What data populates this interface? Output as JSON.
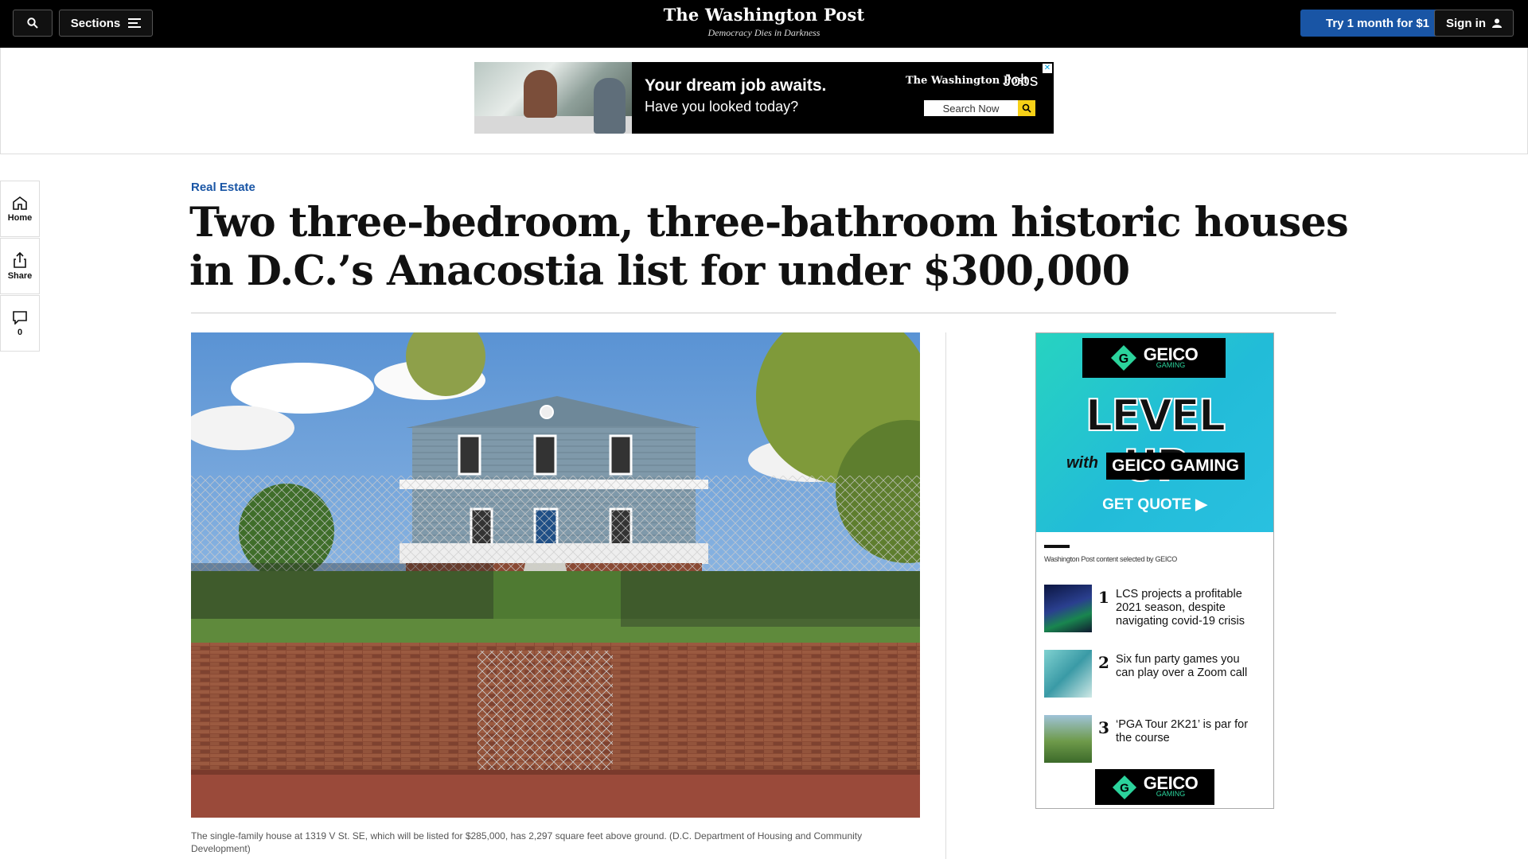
{
  "topbar": {
    "search_icon": "search-icon",
    "sections_label": "Sections",
    "logo": "The Washington Post",
    "tagline": "Democracy Dies in Darkness",
    "try_label": "Try 1 month for $1",
    "signin_label": "Sign in"
  },
  "top_ad": {
    "headline": "Your dream job awaits.",
    "subline": "Have you looked today?",
    "logo": "The Washington Post",
    "jobs": "Jobs",
    "search_label": "Search Now"
  },
  "rail": {
    "home": "Home",
    "share": "Share",
    "comments_count": "0"
  },
  "article": {
    "kicker": "Real Estate",
    "headline": "Two three-bedroom, three-bathroom historic houses in D.C.’s Anacostia list for under $300,000",
    "caption": "The single-family house at 1319 V St. SE, which will be listed for $285,000, has 2,297 square feet above ground. (D.C. Department of Housing and Community Development)"
  },
  "side_ad": {
    "brand": "GEICO",
    "brand_sub": "GAMING",
    "level_up": "LEVEL UP",
    "with": "with",
    "geico_gaming": "GEICO GAMING",
    "get_quote": "GET QUOTE ▶",
    "selected_by": "Washington Post content selected by GEICO",
    "items": [
      {
        "num": "1",
        "title": "LCS projects a profitable 2021 season, despite navigating covid-19 crisis"
      },
      {
        "num": "2",
        "title": "Six fun party games you can play over a Zoom call"
      },
      {
        "num": "3",
        "title": "‘PGA Tour 2K21’ is par for the course"
      }
    ]
  }
}
